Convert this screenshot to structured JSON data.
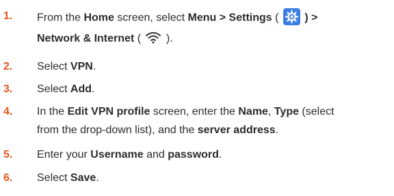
{
  "steps": [
    {
      "number": "1.",
      "lines": [
        {
          "parts": [
            "From the ",
            "Home",
            " screen, select ",
            "Menu > Settings",
            " ( ",
            " ) >"
          ]
        },
        {
          "parts": [
            "Network & Internet",
            " ( ",
            " )."
          ]
        }
      ]
    },
    {
      "number": "2.",
      "parts": [
        "Select ",
        "VPN",
        "."
      ]
    },
    {
      "number": "3.",
      "parts": [
        "Select ",
        "Add",
        "."
      ]
    },
    {
      "number": "4.",
      "line1": [
        "In the ",
        "Edit VPN profile",
        " screen, enter the ",
        "Name",
        ", ",
        "Type",
        " (select"
      ],
      "line2": [
        "from the drop-down list), and the ",
        "server address",
        "."
      ]
    },
    {
      "number": "5.",
      "parts": [
        "Enter your ",
        "Username",
        " and ",
        "password",
        "."
      ]
    },
    {
      "number": "6.",
      "parts": [
        "Select ",
        "Save",
        "."
      ]
    }
  ],
  "icons": {
    "settings": "gear-icon",
    "network": "wifi-icon"
  },
  "colors": {
    "step_number": "#e4571e",
    "text": "#2b2b2b",
    "settings_icon_bg": "#3d7fe0"
  }
}
